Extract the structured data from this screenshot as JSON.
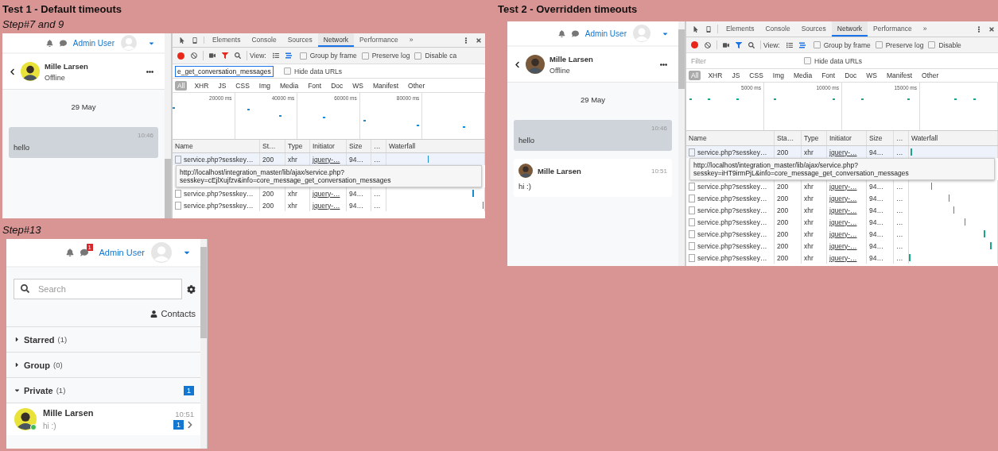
{
  "test1": {
    "title": "Test 1 - Default timeouts",
    "step": "Step#7 and 9",
    "header": {
      "user": "Admin User"
    },
    "conversation": {
      "name": "Mille Larsen",
      "status": "Offline",
      "date": "29 May",
      "messages": [
        {
          "kind": "sent",
          "time": "10:46",
          "text": "hello"
        }
      ]
    },
    "devtools": {
      "tabs": [
        {
          "label": "Elements",
          "selected": false
        },
        {
          "label": "Console",
          "selected": false
        },
        {
          "label": "Sources",
          "selected": false
        },
        {
          "label": "Network",
          "selected": true
        },
        {
          "label": "Performance",
          "selected": false
        }
      ],
      "more": "»",
      "view_label": "View:",
      "options": [
        {
          "label": "Group by frame",
          "checked": false
        },
        {
          "label": "Preserve log",
          "checked": false
        },
        {
          "label": "Disable ca",
          "checked": false
        }
      ],
      "filter": {
        "value": "e_get_conversation_messages"
      },
      "hide_data_urls": {
        "label": "Hide data URLs",
        "checked": false
      },
      "types": [
        {
          "label": "All",
          "selected": true
        },
        {
          "label": "XHR",
          "selected": false
        },
        {
          "label": "JS",
          "selected": false
        },
        {
          "label": "CSS",
          "selected": false
        },
        {
          "label": "Img",
          "selected": false
        },
        {
          "label": "Media",
          "selected": false
        },
        {
          "label": "Font",
          "selected": false
        },
        {
          "label": "Doc",
          "selected": false
        },
        {
          "label": "WS",
          "selected": false
        },
        {
          "label": "Manifest",
          "selected": false
        },
        {
          "label": "Other",
          "selected": false
        }
      ],
      "ticks": [
        "20000 ms",
        "40000 ms",
        "60000 ms",
        "80000 ms"
      ],
      "columns": [
        "Name",
        "St…",
        "Type",
        "Initiator",
        "Size",
        "…",
        "Waterfall"
      ],
      "rows_before": [
        {
          "name": "service.php?sesskey…",
          "status": "200",
          "type": "xhr",
          "initiator": "jquery-…",
          "size": "94…",
          "more": "…"
        }
      ],
      "tooltip": [
        "http://localhost/integration_master/lib/ajax/service.php?",
        "sesskey=cEjlXujfzv&info=core_message_get_conversation_messages"
      ],
      "rows_after": [
        {
          "name": "service.php?sesskey…",
          "status": "200",
          "type": "xhr",
          "initiator": "jquery-…",
          "size": "94…",
          "more": "…"
        },
        {
          "name": "service.php?sesskey…",
          "status": "200",
          "type": "xhr",
          "initiator": "jquery-…",
          "size": "94…",
          "more": "…"
        }
      ]
    }
  },
  "step13": {
    "step": "Step#13",
    "header": {
      "user": "Admin User",
      "badge": "1"
    },
    "search": {
      "placeholder": "Search"
    },
    "contacts_link": "Contacts",
    "sections": [
      {
        "label": "Starred",
        "count": "(1)",
        "expanded": false
      },
      {
        "label": "Group",
        "count": "(0)",
        "expanded": false
      },
      {
        "label": "Private",
        "count": "(1)",
        "expanded": true,
        "badge": "1"
      }
    ],
    "contacts": [
      {
        "name": "Mille Larsen",
        "preview": "hi :)",
        "time": "10:51",
        "badge": "1",
        "online": true
      }
    ]
  },
  "test2": {
    "title": "Test 2 - Overridden timeouts",
    "header": {
      "user": "Admin User"
    },
    "conversation": {
      "name": "Mille Larsen",
      "status": "Offline",
      "date": "29 May",
      "messages": [
        {
          "kind": "sent",
          "time": "10:46",
          "text": "hello"
        },
        {
          "kind": "received",
          "sender": "Mille Larsen",
          "time": "10:51",
          "text": "hi :)"
        }
      ]
    },
    "devtools": {
      "tabs": [
        {
          "label": "Elements",
          "selected": false
        },
        {
          "label": "Console",
          "selected": false
        },
        {
          "label": "Sources",
          "selected": false
        },
        {
          "label": "Network",
          "selected": true
        },
        {
          "label": "Performance",
          "selected": false
        }
      ],
      "more": "»",
      "view_label": "View:",
      "options": [
        {
          "label": "Group by frame",
          "checked": false
        },
        {
          "label": "Preserve log",
          "checked": false
        },
        {
          "label": "Disable",
          "checked": false
        }
      ],
      "filter": {
        "placeholder": "Filter"
      },
      "hide_data_urls": {
        "label": "Hide data URLs",
        "checked": false
      },
      "types": [
        {
          "label": "All",
          "selected": true
        },
        {
          "label": "XHR",
          "selected": false
        },
        {
          "label": "JS",
          "selected": false
        },
        {
          "label": "CSS",
          "selected": false
        },
        {
          "label": "Img",
          "selected": false
        },
        {
          "label": "Media",
          "selected": false
        },
        {
          "label": "Font",
          "selected": false
        },
        {
          "label": "Doc",
          "selected": false
        },
        {
          "label": "WS",
          "selected": false
        },
        {
          "label": "Manifest",
          "selected": false
        },
        {
          "label": "Other",
          "selected": false
        }
      ],
      "ticks": [
        "5000 ms",
        "10000 ms",
        "15000 ms"
      ],
      "columns": [
        "Name",
        "Sta…",
        "Type",
        "Initiator",
        "Size",
        "…",
        "Waterfall"
      ],
      "rows_before": [
        {
          "name": "service.php?sesskey…",
          "status": "200",
          "type": "xhr",
          "initiator": "jquery-…",
          "size": "94…",
          "more": "…"
        }
      ],
      "tooltip": [
        "http://localhost/integration_master/lib/ajax/service.php?",
        "sesskey=iHT9irmPjL&info=core_message_get_conversation_messages"
      ],
      "rows_after": [
        {
          "name": "service.php?sesskey…",
          "status": "200",
          "type": "xhr",
          "initiator": "jquery-…",
          "size": "94…",
          "more": "…"
        },
        {
          "name": "service.php?sesskey…",
          "status": "200",
          "type": "xhr",
          "initiator": "jquery-…",
          "size": "94…",
          "more": "…"
        },
        {
          "name": "service.php?sesskey…",
          "status": "200",
          "type": "xhr",
          "initiator": "jquery-…",
          "size": "94…",
          "more": "…"
        },
        {
          "name": "service.php?sesskey…",
          "status": "200",
          "type": "xhr",
          "initiator": "jquery-…",
          "size": "94…",
          "more": "…"
        },
        {
          "name": "service.php?sesskey…",
          "status": "200",
          "type": "xhr",
          "initiator": "jquery-…",
          "size": "94…",
          "more": "…"
        },
        {
          "name": "service.php?sesskey…",
          "status": "200",
          "type": "xhr",
          "initiator": "jquery-…",
          "size": "94…",
          "more": "…"
        },
        {
          "name": "service.php?sesskey…",
          "status": "200",
          "type": "xhr",
          "initiator": "jquery-…",
          "size": "94…",
          "more": "…"
        }
      ]
    }
  }
}
